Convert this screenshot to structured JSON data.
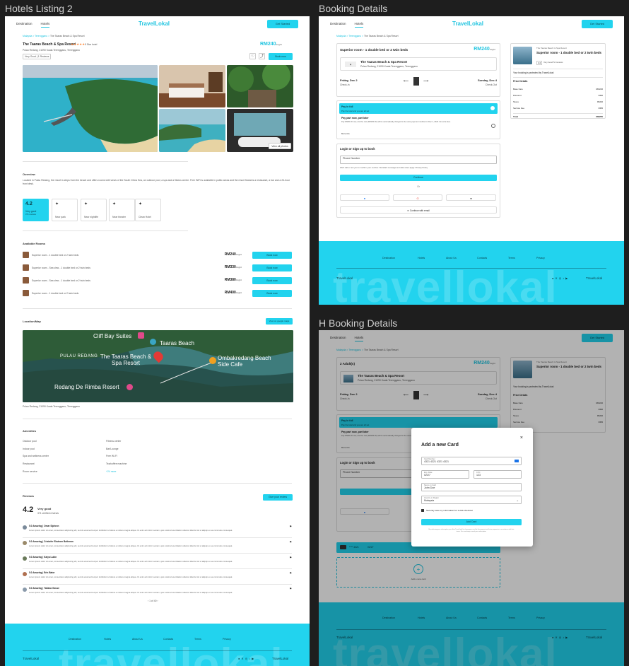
{
  "frames": {
    "f1": "Hotels Listing 2",
    "f2": "Booking Details",
    "f3": "H Booking Details"
  },
  "nav": {
    "destination": "Destination",
    "hotels": "Hotels",
    "logo": "TravelLokal",
    "cta": "Get Started"
  },
  "hotel": {
    "breadcrumb": [
      "Malaysia",
      ">",
      "Terengganu",
      ">",
      "The Taaras Beach & Spa Resort"
    ],
    "name": "The Taaras Beach & Spa Resort",
    "stars": "★★★★★",
    "stars_note": "5 Star hotel",
    "address": "Pulau Redang, 21090 Kuala Terengganu, Terengganu",
    "reviews_link": "Very Good | 1 Reviews",
    "price": "RM240",
    "per": "/night",
    "book": "Book now",
    "view_photos": "View all photos"
  },
  "overview": {
    "title": "Overview",
    "text": "Located in Pulau Redang, the resort is steps from the beach and offers rooms with views of the South China Sea, an outdoor pool, a spa and a fitness centre. Free WiFi is available in public areas and the resort features a restaurant, a bar and a 24-hour front desk.",
    "score": "4.2",
    "score_label": "Very good",
    "score_sub": "371 reviews",
    "features": [
      "Near park",
      "Near nightlife",
      "Near theater",
      "Clean Hotel"
    ]
  },
  "rooms": {
    "title": "Available Rooms",
    "items": [
      {
        "name": "Superior room - 1 double bed or 2 twin beds",
        "price": "RM240",
        "per": "/night",
        "btn": "Book now"
      },
      {
        "name": "Superior room - Sea view - 1 double bed or 2 twin beds",
        "price": "RM330",
        "per": "/night",
        "btn": "Book now"
      },
      {
        "name": "Superior room - Sea view - 1 double bed or 2 twin beds",
        "price": "RM380",
        "per": "/night",
        "btn": "Book now"
      },
      {
        "name": "Superior room - 1 double bed or 2 twin beds",
        "price": "RM400",
        "per": "/night",
        "btn": "Book now"
      }
    ]
  },
  "map": {
    "title": "Location/Map",
    "btn": "View on google maps",
    "labels": [
      "Cliff Bay Suites",
      "Taaras Beach",
      "PULAU REDANG",
      "The Taaras Beach & Spa Resort",
      "Ombakredang Beach Side Cafe",
      "Redang De Rimba Resort"
    ],
    "address": "Pulau Redang, 21090 Kuala Terengganu, Terengganu"
  },
  "amenities": {
    "title": "Amenities",
    "left": [
      "Outdoor pool",
      "Indoor pool",
      "Spa and wellness center",
      "Restaurant",
      "Room service"
    ],
    "right": [
      "Fitness center",
      "Bar/Lounge",
      "Free Wi-Fi",
      "Tea/coffee machine",
      "+24 more"
    ]
  },
  "reviews": {
    "title": "Reviews",
    "btn": "Give your review",
    "score": "4.2",
    "label": "Very good",
    "sub": "371 verified reviews",
    "items": [
      {
        "head": "5.0 Amazing | Omar Siphron",
        "text": "Lorem ipsum dolor sit amet, consectetur adipiscing elit, sed do eiusmod tempor incididunt ut labore et dolore magna aliqua. Ut enim ad minim veniam, quis nostrud exercitation ullamco laboris nisi ut aliquip ex ea commodo consequat."
      },
      {
        "head": "5.0 Amazing | Cristofer Ekstrom Bothman",
        "text": "Lorem ipsum dolor sit amet, consectetur adipiscing elit, sed do eiusmod tempor incididunt ut labore et dolore magna aliqua. Ut enim ad minim veniam, quis nostrud exercitation ullamco laboris nisi ut aliquip ex ea commodo consequat."
      },
      {
        "head": "5.0 Amazing | Kaiya Lubin",
        "text": "Lorem ipsum dolor sit amet, consectetur adipiscing elit, sed do eiusmod tempor incididunt ut labore et dolore magna aliqua. Ut enim ad minim veniam, quis nostrud exercitation ullamco laboris nisi ut aliquip ex ea commodo consequat."
      },
      {
        "head": "5.0 Amazing | Erin Bator",
        "text": "Lorem ipsum dolor sit amet, consectetur adipiscing elit, sed do eiusmod tempor incididunt ut labore et dolore magna aliqua. Ut enim ad minim veniam, quis nostrud exercitation ullamco laboris nisi ut aliquip ex ea commodo consequat."
      },
      {
        "head": "5.0 Amazing | Tatiana Gouse",
        "text": "Lorem ipsum dolor sit amet, consectetur adipiscing elit, sed do eiusmod tempor incididunt ut labore et dolore magna aliqua. Ut enim ad minim veniam, quis nostrud exercitation ullamco laboris nisi ut aliquip ex ea commodo consequat."
      }
    ],
    "pager": "1 of 40"
  },
  "footer": {
    "links": [
      "Destination",
      "Hotels",
      "About Us",
      "Contacts",
      "Terms",
      "Privacy"
    ],
    "logo": "TravelLokal",
    "big": "travellokal"
  },
  "booking": {
    "room": "Superior room - 1 double bed or 2 twin beds",
    "price": "RM240",
    "per": "/night",
    "hotel": "The Taaras Beach & Spa Resort",
    "addr": "Pulau Redang, 21090 Kuala Terengganu, Terengganu",
    "checkin": "Friday, Dec 2",
    "checkin_sub": "Check-In",
    "checkout": "Sunday, Dec 4",
    "checkout_sub": "Check-Out",
    "pay_full": "Pay in full",
    "pay_full_sub": "Pay the total and you are all set",
    "pay_part": "Pay part now, part later",
    "pay_part_sub": "Pay RM60.00 now, and the rest (RM180.00) will be automatically charged to the same payment method on Dec 1, 2023. No extra fees.",
    "more": "More info",
    "login_title": "Login or Sign up to book",
    "phone": "Phone Number",
    "phone_note": "We'll call or text you to confirm your number. Standard message and data rates apply. Privacy Policy",
    "continue": "Continue",
    "or": "Or",
    "email_btn": "Continue with email",
    "side_hotel": "The Taaras Beach & Spa Resort",
    "side_room": "Superior room - 1 double bed or 2 twin beds",
    "side_rating": "4.2",
    "side_rating_label": "Very Good 54 reviews",
    "protected": "Your booking is protected by TravelLokal",
    "price_title": "Price Details",
    "price_rows": [
      [
        "Base Fare",
        "RM240"
      ],
      [
        "Discount",
        "RM0"
      ],
      [
        "Taxes",
        "RM20"
      ],
      [
        "Service Fee",
        "RM5"
      ]
    ],
    "total": [
      "Total",
      "RM265"
    ]
  },
  "h_booking": {
    "adults": "2 Adult(s)",
    "saved_card": "**** 4321",
    "saved_exp": "02/27",
    "add_card": "Add a new card"
  },
  "modal": {
    "title": "Add a new Card",
    "close": "×",
    "card_label": "Card Number",
    "card_val": "4321 4321 4321 4321",
    "exp_label": "Exp. Date",
    "exp_val": "02/27",
    "cvc_label": "CVC",
    "cvc_val": "123",
    "name_label": "Name on Card",
    "name_val": "John Doe",
    "country_label": "Country or Region",
    "country_val": "Malaysia",
    "securely": "Securely save my information for 1-click checkout",
    "btn": "Add Card",
    "note": "By confirming your subscription, you allow TravelLokal to charge your card for this payment and future payments in accordance with their terms. You can always cancel your subscription."
  },
  "colors": {
    "accent": "#22d3ee",
    "brand": "#22c5e0"
  }
}
